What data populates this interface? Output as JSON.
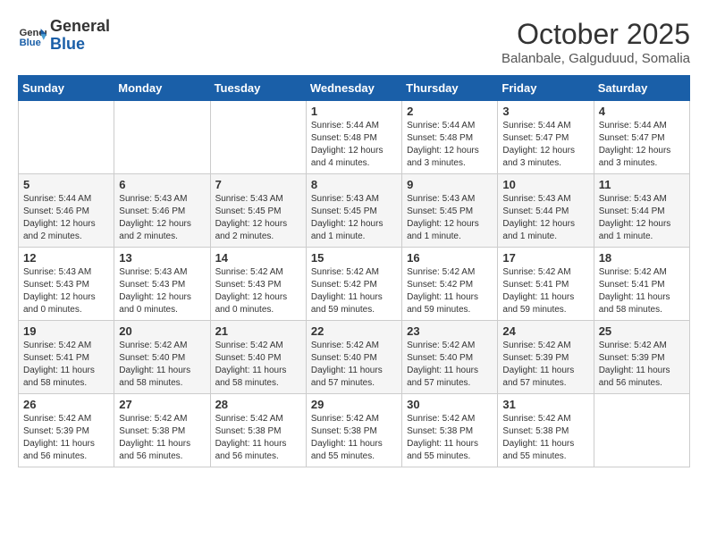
{
  "header": {
    "logo_line1": "General",
    "logo_line2": "Blue",
    "month": "October 2025",
    "location": "Balanbale, Galguduud, Somalia"
  },
  "weekdays": [
    "Sunday",
    "Monday",
    "Tuesday",
    "Wednesday",
    "Thursday",
    "Friday",
    "Saturday"
  ],
  "weeks": [
    [
      {
        "day": "",
        "info": ""
      },
      {
        "day": "",
        "info": ""
      },
      {
        "day": "",
        "info": ""
      },
      {
        "day": "1",
        "info": "Sunrise: 5:44 AM\nSunset: 5:48 PM\nDaylight: 12 hours\nand 4 minutes."
      },
      {
        "day": "2",
        "info": "Sunrise: 5:44 AM\nSunset: 5:48 PM\nDaylight: 12 hours\nand 3 minutes."
      },
      {
        "day": "3",
        "info": "Sunrise: 5:44 AM\nSunset: 5:47 PM\nDaylight: 12 hours\nand 3 minutes."
      },
      {
        "day": "4",
        "info": "Sunrise: 5:44 AM\nSunset: 5:47 PM\nDaylight: 12 hours\nand 3 minutes."
      }
    ],
    [
      {
        "day": "5",
        "info": "Sunrise: 5:44 AM\nSunset: 5:46 PM\nDaylight: 12 hours\nand 2 minutes."
      },
      {
        "day": "6",
        "info": "Sunrise: 5:43 AM\nSunset: 5:46 PM\nDaylight: 12 hours\nand 2 minutes."
      },
      {
        "day": "7",
        "info": "Sunrise: 5:43 AM\nSunset: 5:45 PM\nDaylight: 12 hours\nand 2 minutes."
      },
      {
        "day": "8",
        "info": "Sunrise: 5:43 AM\nSunset: 5:45 PM\nDaylight: 12 hours\nand 1 minute."
      },
      {
        "day": "9",
        "info": "Sunrise: 5:43 AM\nSunset: 5:45 PM\nDaylight: 12 hours\nand 1 minute."
      },
      {
        "day": "10",
        "info": "Sunrise: 5:43 AM\nSunset: 5:44 PM\nDaylight: 12 hours\nand 1 minute."
      },
      {
        "day": "11",
        "info": "Sunrise: 5:43 AM\nSunset: 5:44 PM\nDaylight: 12 hours\nand 1 minute."
      }
    ],
    [
      {
        "day": "12",
        "info": "Sunrise: 5:43 AM\nSunset: 5:43 PM\nDaylight: 12 hours\nand 0 minutes."
      },
      {
        "day": "13",
        "info": "Sunrise: 5:43 AM\nSunset: 5:43 PM\nDaylight: 12 hours\nand 0 minutes."
      },
      {
        "day": "14",
        "info": "Sunrise: 5:42 AM\nSunset: 5:43 PM\nDaylight: 12 hours\nand 0 minutes."
      },
      {
        "day": "15",
        "info": "Sunrise: 5:42 AM\nSunset: 5:42 PM\nDaylight: 11 hours\nand 59 minutes."
      },
      {
        "day": "16",
        "info": "Sunrise: 5:42 AM\nSunset: 5:42 PM\nDaylight: 11 hours\nand 59 minutes."
      },
      {
        "day": "17",
        "info": "Sunrise: 5:42 AM\nSunset: 5:41 PM\nDaylight: 11 hours\nand 59 minutes."
      },
      {
        "day": "18",
        "info": "Sunrise: 5:42 AM\nSunset: 5:41 PM\nDaylight: 11 hours\nand 58 minutes."
      }
    ],
    [
      {
        "day": "19",
        "info": "Sunrise: 5:42 AM\nSunset: 5:41 PM\nDaylight: 11 hours\nand 58 minutes."
      },
      {
        "day": "20",
        "info": "Sunrise: 5:42 AM\nSunset: 5:40 PM\nDaylight: 11 hours\nand 58 minutes."
      },
      {
        "day": "21",
        "info": "Sunrise: 5:42 AM\nSunset: 5:40 PM\nDaylight: 11 hours\nand 58 minutes."
      },
      {
        "day": "22",
        "info": "Sunrise: 5:42 AM\nSunset: 5:40 PM\nDaylight: 11 hours\nand 57 minutes."
      },
      {
        "day": "23",
        "info": "Sunrise: 5:42 AM\nSunset: 5:40 PM\nDaylight: 11 hours\nand 57 minutes."
      },
      {
        "day": "24",
        "info": "Sunrise: 5:42 AM\nSunset: 5:39 PM\nDaylight: 11 hours\nand 57 minutes."
      },
      {
        "day": "25",
        "info": "Sunrise: 5:42 AM\nSunset: 5:39 PM\nDaylight: 11 hours\nand 56 minutes."
      }
    ],
    [
      {
        "day": "26",
        "info": "Sunrise: 5:42 AM\nSunset: 5:39 PM\nDaylight: 11 hours\nand 56 minutes."
      },
      {
        "day": "27",
        "info": "Sunrise: 5:42 AM\nSunset: 5:38 PM\nDaylight: 11 hours\nand 56 minutes."
      },
      {
        "day": "28",
        "info": "Sunrise: 5:42 AM\nSunset: 5:38 PM\nDaylight: 11 hours\nand 56 minutes."
      },
      {
        "day": "29",
        "info": "Sunrise: 5:42 AM\nSunset: 5:38 PM\nDaylight: 11 hours\nand 55 minutes."
      },
      {
        "day": "30",
        "info": "Sunrise: 5:42 AM\nSunset: 5:38 PM\nDaylight: 11 hours\nand 55 minutes."
      },
      {
        "day": "31",
        "info": "Sunrise: 5:42 AM\nSunset: 5:38 PM\nDaylight: 11 hours\nand 55 minutes."
      },
      {
        "day": "",
        "info": ""
      }
    ]
  ]
}
